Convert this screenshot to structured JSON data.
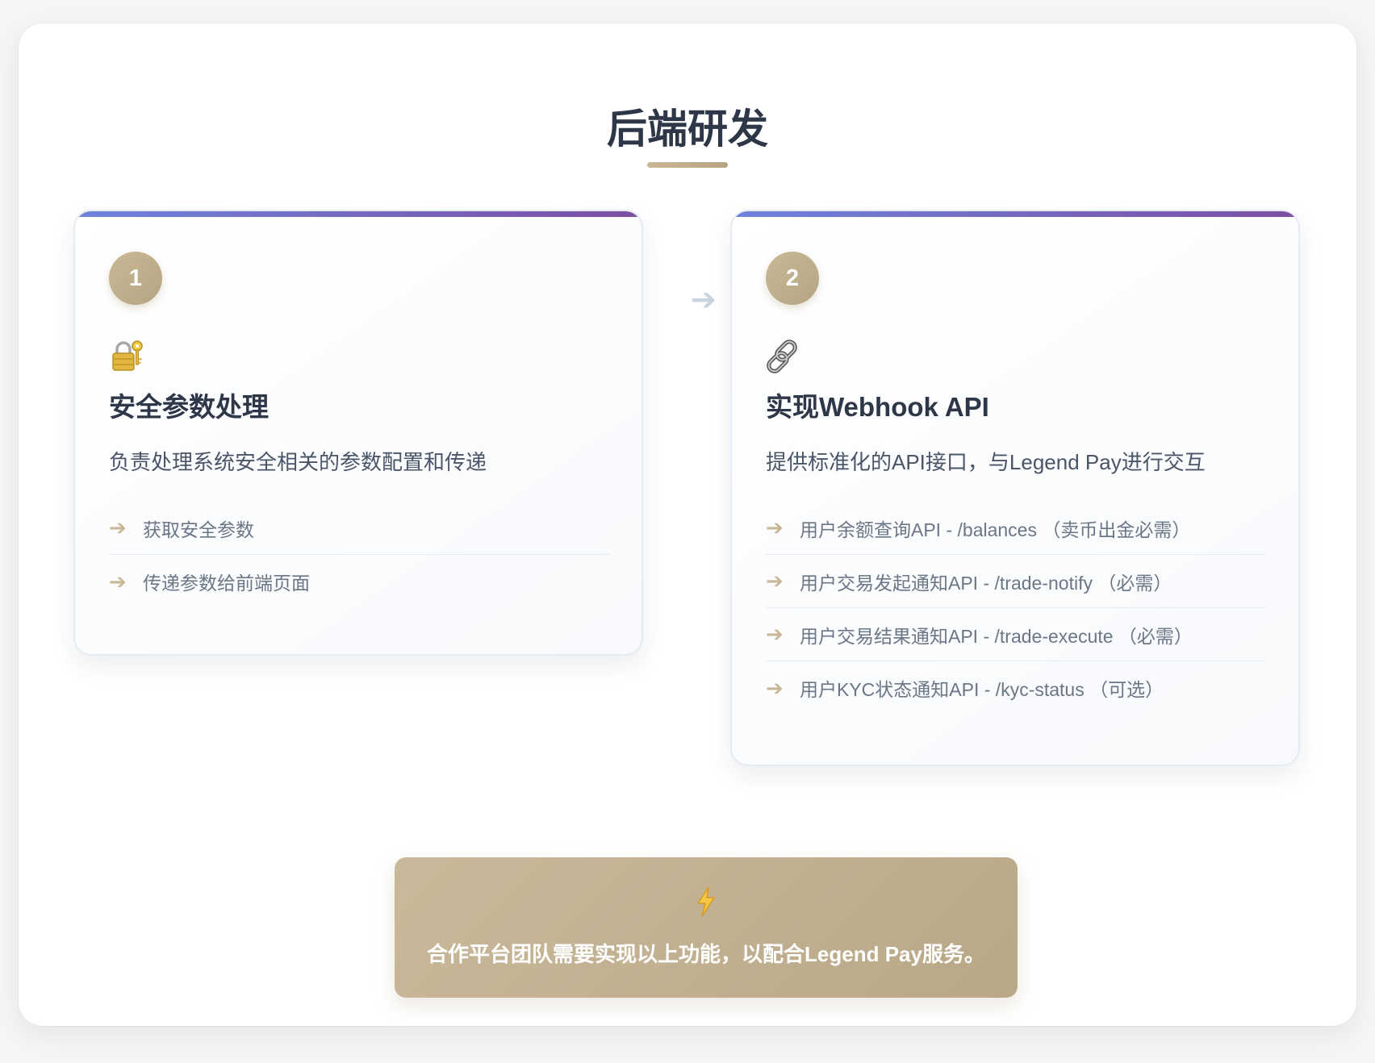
{
  "page": {
    "title": "后端研发"
  },
  "flow": {
    "arrow_icon": "arrow-right-icon",
    "arrow_glyph": "➔"
  },
  "cards": [
    {
      "step": "1",
      "icon": "lock-with-key-icon",
      "title": "安全参数处理",
      "description": "负责处理系统安全相关的参数配置和传递",
      "items": [
        "获取安全参数",
        "传递参数给前端页面"
      ]
    },
    {
      "step": "2",
      "icon": "link-icon",
      "title": "实现Webhook API",
      "description": "提供标准化的API接口，与Legend Pay进行交互",
      "items": [
        "用户余额查询API - /balances （卖币出金必需）",
        "用户交易发起通知API - /trade-notify （必需）",
        "用户交易结果通知API - /trade-execute （必需）",
        "用户KYC状态通知API - /kyc-status （可选）"
      ]
    }
  ],
  "item_arrow_glyph": "➔",
  "note": {
    "icon": "lightning-icon",
    "glyph": "⚡",
    "text": "合作平台团队需要实现以上功能，以配合Legend Pay服务。"
  },
  "colors": {
    "accent_gold": "#c8b896",
    "card_top_gradient_start": "#6e83dc",
    "card_top_gradient_end": "#7c4fa3",
    "title_text": "#2d3748"
  }
}
